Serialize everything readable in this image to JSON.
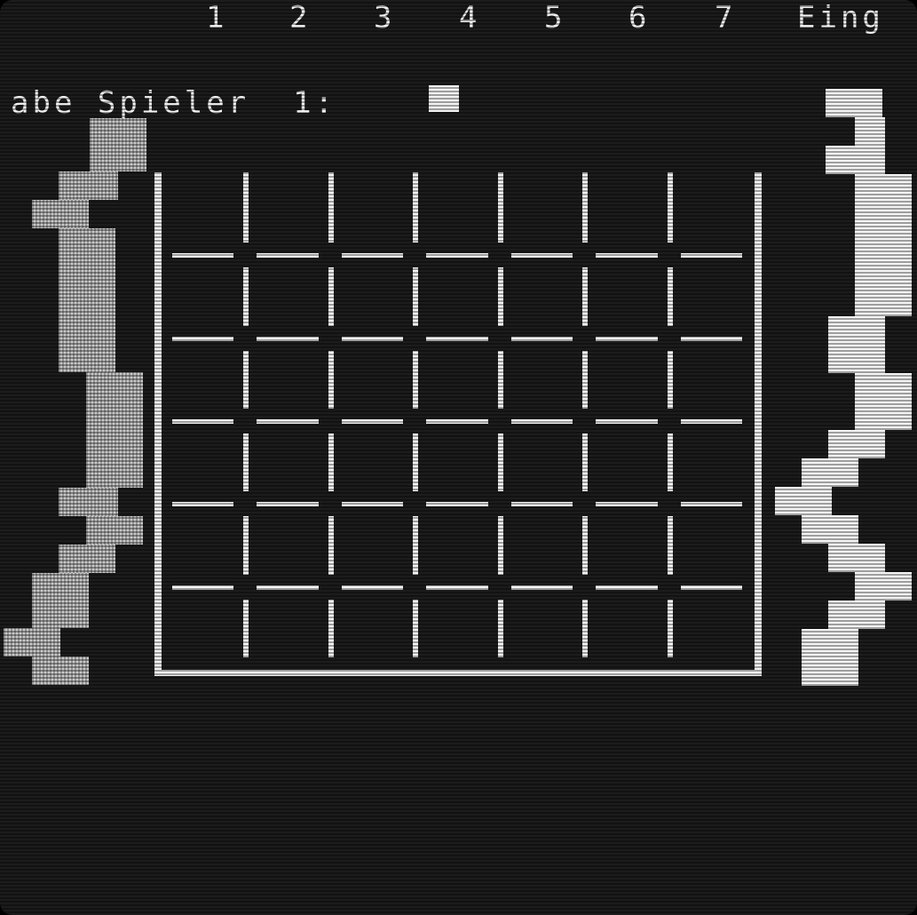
{
  "header": {
    "columns": [
      "1",
      "2",
      "3",
      "4",
      "5",
      "6",
      "7"
    ],
    "right_text": "Eing"
  },
  "prompt": {
    "text": "abe Spieler  1:"
  },
  "board": {
    "columns": 7,
    "rows": 6
  },
  "colors": {
    "background": "#1c1c1c",
    "foreground": "#f4f4f4",
    "left_decor": "#c9c9c9"
  }
}
